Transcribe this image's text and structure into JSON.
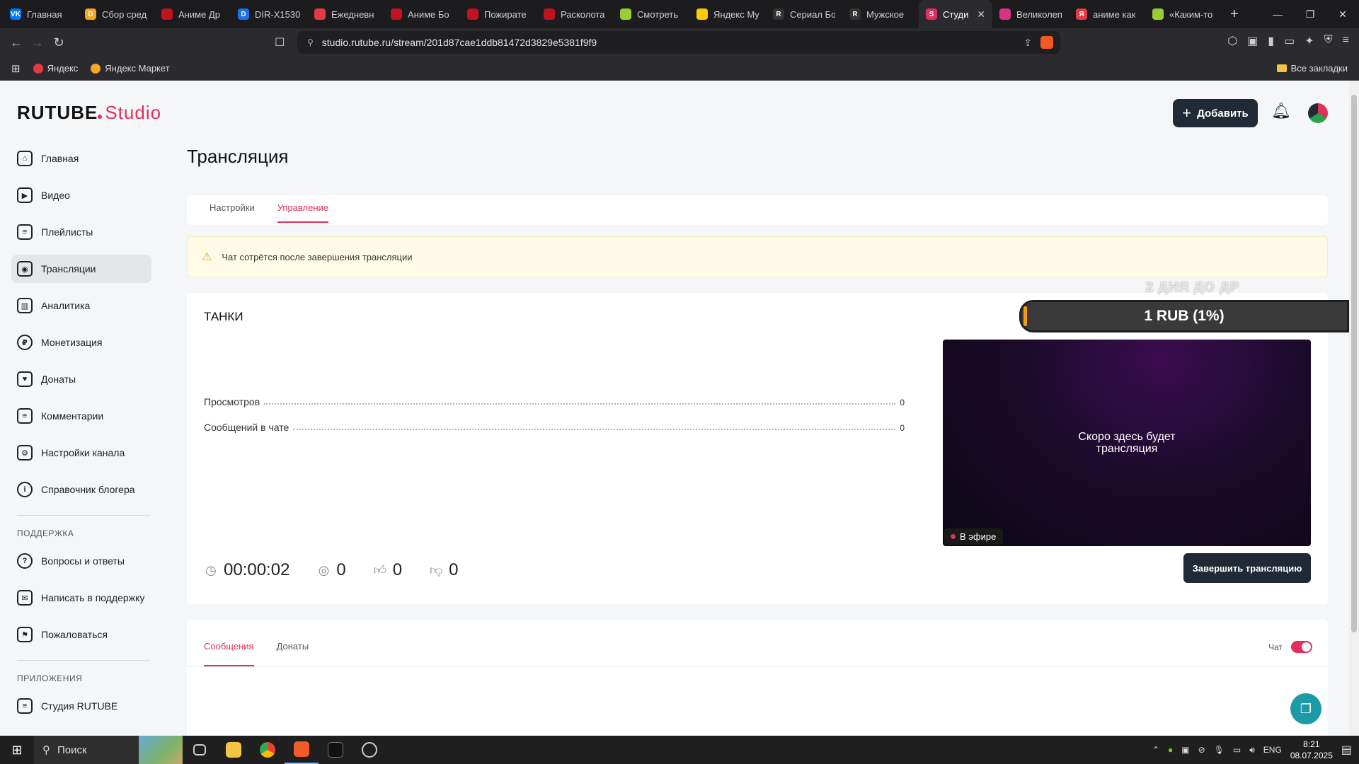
{
  "browser": {
    "tabs": [
      {
        "label": "Главная",
        "color": "#0077ff",
        "glyph": "VK"
      },
      {
        "label": "Сбор сред",
        "color": "#f5a623",
        "glyph": "D"
      },
      {
        "label": "Аниме Др",
        "color": "#c1121f",
        "glyph": ""
      },
      {
        "label": "DIR-X1530",
        "color": "#1a73e8",
        "glyph": "D"
      },
      {
        "label": "Ежедневн",
        "color": "#e63946",
        "glyph": ""
      },
      {
        "label": "Аниме Бо",
        "color": "#c1121f",
        "glyph": ""
      },
      {
        "label": "Пожирате",
        "color": "#c1121f",
        "glyph": ""
      },
      {
        "label": "Расколота",
        "color": "#c1121f",
        "glyph": ""
      },
      {
        "label": "Смотреть",
        "color": "#9acd32",
        "glyph": ""
      },
      {
        "label": "Яндекс Му",
        "color": "#ffcc00",
        "glyph": ""
      },
      {
        "label": "Сериал Бо",
        "color": "#333333",
        "glyph": "R"
      },
      {
        "label": "Мужское",
        "color": "#333333",
        "glyph": "R"
      },
      {
        "label": "Студи",
        "color": "#e0315c",
        "glyph": "S",
        "active": true
      },
      {
        "label": "Великолеп",
        "color": "#d63384",
        "glyph": ""
      },
      {
        "label": "аниме как",
        "color": "#e63946",
        "glyph": "Я"
      },
      {
        "label": "«Каким-то",
        "color": "#9acd32",
        "glyph": ""
      }
    ],
    "url": "studio.rutube.ru/stream/201d87cae1ddb81472d3829e5381f9f9",
    "bookmarks": [
      {
        "label": "Яндекс",
        "color": "#e63946"
      },
      {
        "label": "Яндекс Маркет",
        "color": "#f5a623"
      }
    ],
    "all_bookmarks": "Все закладки"
  },
  "app": {
    "logo_main": "RUTUBE",
    "logo_studio": "Studio",
    "add_button": "Добавить",
    "sidebar": {
      "items": [
        {
          "label": "Главная",
          "icon": "home-icon",
          "glyph": "⌂"
        },
        {
          "label": "Видео",
          "icon": "video-icon",
          "glyph": "▶"
        },
        {
          "label": "Плейлисты",
          "icon": "playlist-icon",
          "glyph": "≡"
        },
        {
          "label": "Трансляции",
          "icon": "broadcast-icon",
          "glyph": "◉",
          "active": true
        },
        {
          "label": "Аналитика",
          "icon": "analytics-icon",
          "glyph": "▥"
        },
        {
          "label": "Монетизация",
          "icon": "ruble-icon",
          "glyph": "₽"
        },
        {
          "label": "Донаты",
          "icon": "donate-icon",
          "glyph": "♥"
        },
        {
          "label": "Комментарии",
          "icon": "comment-icon",
          "glyph": "≡"
        },
        {
          "label": "Настройки канала",
          "icon": "gear-icon",
          "glyph": "⚙"
        },
        {
          "label": "Справочник блогера",
          "icon": "info-icon",
          "glyph": "i"
        }
      ],
      "support_title": "ПОДДЕРЖКА",
      "support_items": [
        {
          "label": "Вопросы и ответы",
          "icon": "question-icon",
          "glyph": "?"
        },
        {
          "label": "Написать в поддержку",
          "icon": "mail-icon",
          "glyph": "✉"
        },
        {
          "label": "Пожаловаться",
          "icon": "flag-icon",
          "glyph": "⚑"
        }
      ],
      "apps_title": "ПРИЛОЖЕНИЯ",
      "apps_items": [
        {
          "label": "Студия RUTUBE",
          "icon": "studio-app-icon",
          "glyph": "≡"
        }
      ]
    },
    "page_title": "Трансляция",
    "tabs": [
      {
        "label": "Настройки"
      },
      {
        "label": "Управление",
        "active": true
      }
    ],
    "warning": "Чат сотрётся после завершения трансляции",
    "stream": {
      "name": "ТАНКИ",
      "stats": [
        {
          "label": "Просмотров",
          "value": "0"
        },
        {
          "label": "Сообщений в чате",
          "value": "0"
        }
      ],
      "timer": "00:00:02",
      "viewers": "0",
      "likes": "0",
      "dislikes": "0",
      "preview_text": "Скоро здесь будет трансляция",
      "live_badge": "В эфире",
      "end_button": "Завершить трансляцию"
    },
    "overlay": {
      "label": "2 ДНЯ ДО ДР",
      "bar_text": "1 RUB (1%)",
      "progress": 0.01
    },
    "chat": {
      "tabs": [
        {
          "label": "Сообщения",
          "active": true
        },
        {
          "label": "Донаты"
        }
      ],
      "toggle_label": "Чат",
      "toggle_on": true
    }
  },
  "taskbar": {
    "search_placeholder": "Поиск",
    "lang": "ENG",
    "time": "8:21",
    "date": "08.07.2025"
  }
}
